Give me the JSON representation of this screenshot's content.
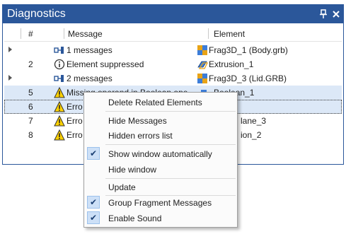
{
  "window": {
    "title": "Diagnostics",
    "pin_glyph": "❙",
    "close_glyph": "✕"
  },
  "columns": {
    "num": "#",
    "message": "Message",
    "element": "Element"
  },
  "rows": [
    {
      "expandable": true,
      "num": "",
      "icon": "message-group-icon",
      "message": "1 messages",
      "element_icon": "fragment-3d-icon",
      "element": "Frag3D_1 (Body.grb)"
    },
    {
      "expandable": false,
      "num": "2",
      "icon": "info-icon",
      "message": "Element suppressed",
      "element_icon": "extrusion-icon",
      "element": "Extrusion_1"
    },
    {
      "expandable": true,
      "num": "",
      "icon": "message-group-icon",
      "message": "2 messages",
      "element_icon": "fragment-3d-icon",
      "element": "Frag3D_3 (Lid.GRB)"
    },
    {
      "expandable": false,
      "num": "5",
      "icon": "warning-icon",
      "message": "Missing operand in Boolean ope...",
      "element_icon": "boolean-icon",
      "element": "Boolean_1"
    },
    {
      "expandable": false,
      "num": "6",
      "icon": "warning-icon",
      "message": "Erro",
      "element_icon": "",
      "element": ""
    },
    {
      "expandable": false,
      "num": "7",
      "icon": "warning-icon",
      "message": "Erro",
      "element_icon": "",
      "element": "lane_3"
    },
    {
      "expandable": false,
      "num": "8",
      "icon": "warning-icon",
      "message": "Erro",
      "element_icon": "",
      "element": "ion_2"
    }
  ],
  "context_menu": {
    "items": [
      {
        "label": "Delete Related Elements",
        "checked": false
      },
      {
        "label": "Hide Messages",
        "checked": false
      },
      {
        "label": "Hidden errors list",
        "checked": false
      },
      {
        "label": "Show window automatically",
        "checked": true
      },
      {
        "label": "Hide window",
        "checked": false
      },
      {
        "label": "Update",
        "checked": false
      },
      {
        "label": "Group Fragment Messages",
        "checked": true
      },
      {
        "label": "Enable Sound",
        "checked": true
      }
    ],
    "check_glyph": "✔"
  },
  "colors": {
    "title_bar": "#2b579a",
    "selection": "#dce8f7",
    "warning": "#ffd200",
    "check_bg": "#cde0f7"
  }
}
